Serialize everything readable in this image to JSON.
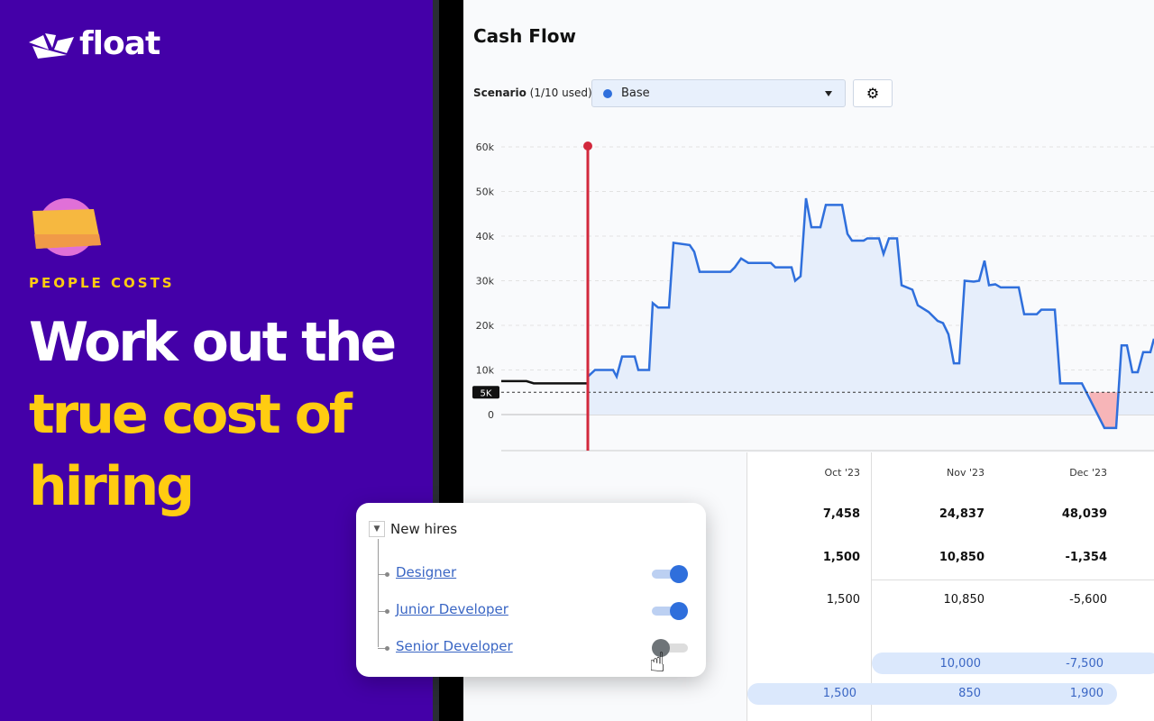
{
  "brand": {
    "name": "float"
  },
  "promo": {
    "eyebrow": "PEOPLE COSTS",
    "line1": "Work out the",
    "line2": "true cost of",
    "line3": "hiring"
  },
  "app": {
    "title": "Cash Flow",
    "scenario_label": "Scenario",
    "scenario_used": "(1/10 used)",
    "scenario_value": "Base",
    "scenario_color": "#2f6fdc"
  },
  "chart_data": {
    "type": "area",
    "y_ticks": [
      "60k",
      "50k",
      "40k",
      "30k",
      "20k",
      "10k",
      "0"
    ],
    "threshold_label": "5K",
    "threshold": 5,
    "ylim": [
      -8,
      60
    ],
    "y_unit": "k",
    "actual_values": [
      7.5,
      7.5,
      7,
      7,
      7
    ],
    "forecast_values": [
      8.5,
      10,
      10,
      8.5,
      13,
      13,
      10,
      10,
      25,
      24,
      24,
      38.5,
      38,
      36.5,
      32,
      32,
      33,
      35,
      34,
      34,
      33,
      33,
      30,
      31,
      48.5,
      42,
      42,
      47,
      47,
      40.5,
      39,
      39,
      39.5,
      39.5,
      36,
      39.5,
      39.5,
      29,
      28,
      24.5,
      23,
      21,
      20.5,
      18,
      11.5,
      11.5,
      30,
      29.8,
      30,
      34.5,
      29,
      29.2,
      28.5,
      28.5,
      22.5,
      22.5,
      23.5,
      23.5,
      7,
      7,
      3,
      -3,
      -3,
      15.5,
      15.5,
      9.5,
      9.5,
      14,
      14,
      17
    ],
    "colors": {
      "forecast": "#2f6fdc",
      "today": "#d2283c",
      "below_threshold": "#f7b5b8"
    }
  },
  "table": {
    "months": [
      "Oct '23",
      "Nov '23",
      "Dec '23"
    ],
    "row1": [
      "7,458",
      "24,837",
      "48,039"
    ],
    "row2": [
      "1,500",
      "10,850",
      "-1,354"
    ],
    "row3": [
      "1,500",
      "10,850",
      "-5,600"
    ],
    "row4": [
      "10,000",
      "-7,500"
    ],
    "row5": [
      "1,500",
      "850",
      "1,900"
    ]
  },
  "hires": {
    "group": "New hires",
    "items": [
      {
        "label": "Designer",
        "on": true
      },
      {
        "label": "Junior Developer",
        "on": true
      },
      {
        "label": "Senior Developer",
        "on": false
      }
    ]
  }
}
